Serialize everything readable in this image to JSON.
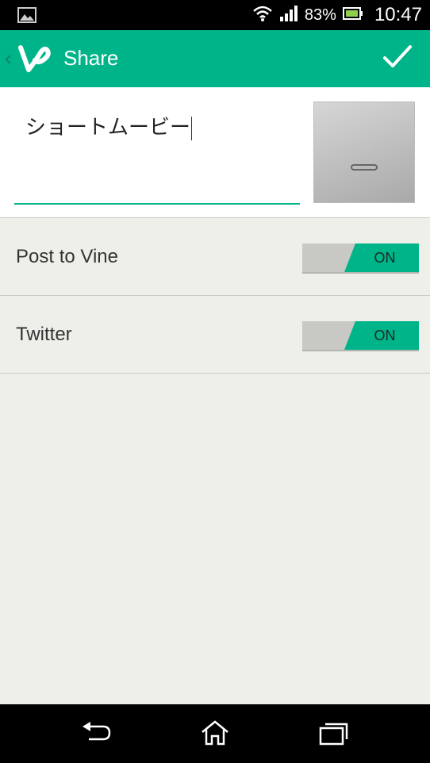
{
  "status_bar": {
    "battery_percent": "83%",
    "time": "10:47",
    "icons": [
      "gallery-icon",
      "wifi-icon",
      "signal-icon",
      "battery-icon"
    ]
  },
  "action_bar": {
    "title": "Share",
    "logo": "vine-logo",
    "color": "#00b489"
  },
  "caption": {
    "value": "ショートムービー"
  },
  "options": [
    {
      "label": "Post to Vine",
      "state": "ON"
    },
    {
      "label": "Twitter",
      "state": "ON"
    }
  ],
  "nav_bar": {
    "icons": [
      "back-icon",
      "home-icon",
      "recent-apps-icon"
    ]
  }
}
